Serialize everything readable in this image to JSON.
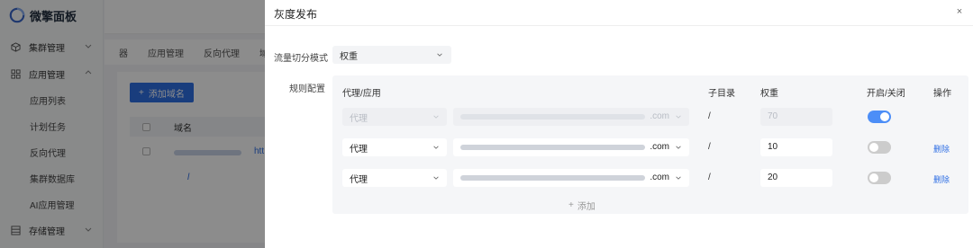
{
  "app": {
    "logo_text": "微擎面板",
    "nav": {
      "cluster_group": "集群管理",
      "app_group": "应用管理",
      "items": [
        "应用列表",
        "计划任务",
        "反向代理",
        "集群数据库",
        "AI应用管理"
      ],
      "storage_group": "存储管理"
    },
    "tabs": [
      "器",
      "应用管理",
      "反向代理",
      "域名"
    ],
    "add_domain_label": "添加域名",
    "table_header_domain": "域名",
    "row_snippet": "htt",
    "loading_mark": "l"
  },
  "drawer": {
    "title": "灰度发布",
    "close_glyph": "×",
    "mode_label": "流量切分模式",
    "mode_value": "权重",
    "rules_label": "规则配置",
    "columns": {
      "proxy_app": "代理/应用",
      "subdir": "子目录",
      "weight": "权重",
      "switch": "开启/关闭",
      "action": "操作"
    },
    "rows": [
      {
        "type": "代理",
        "domain_suffix": ".com",
        "subdir": "/",
        "weight": "70",
        "enabled": true,
        "disabled_row": true,
        "action": ""
      },
      {
        "type": "代理",
        "domain_suffix": ".com",
        "subdir": "/",
        "weight": "10",
        "enabled": false,
        "disabled_row": false,
        "action": "删除"
      },
      {
        "type": "代理",
        "domain_suffix": ".com",
        "subdir": "/",
        "weight": "20",
        "enabled": false,
        "disabled_row": false,
        "action": "删除"
      }
    ],
    "add_label": "添加"
  },
  "colors": {
    "accent": "#2f6fe4",
    "toggle_on": "#4c8ef7",
    "overlay": "rgba(0,0,0,0.45)"
  }
}
